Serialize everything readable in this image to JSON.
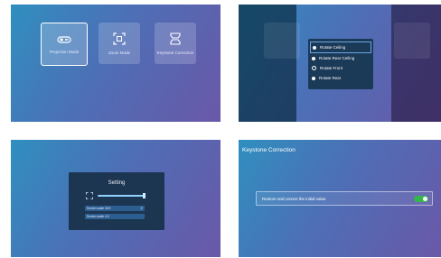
{
  "panel1": {
    "tiles": [
      {
        "label": "Projection Mode",
        "icon": "projector-icon",
        "selected": true
      },
      {
        "label": "Zoom Mode",
        "icon": "zoom-frame-icon",
        "selected": false
      },
      {
        "label": "Keystone Correction",
        "icon": "keystone-icon",
        "selected": false
      }
    ]
  },
  "panel2": {
    "menu": [
      {
        "label": "Rotate Ceiling",
        "selected": true
      },
      {
        "label": "Rotate Rear Ceiling",
        "selected": false
      },
      {
        "label": "Rotate Front",
        "selected": false
      },
      {
        "label": "Rotate Rear",
        "selected": false
      }
    ]
  },
  "panel3": {
    "title": "Setting",
    "options": [
      {
        "label": "Screen scale 16:9",
        "icon": "search-icon"
      },
      {
        "label": "Screen scale 4:3"
      }
    ],
    "slider_level": 1.0
  },
  "panel4": {
    "title": "Keystone Correction",
    "row_label": "Restore and correct the initial value",
    "toggle_on": true,
    "accent": "#36b64a"
  }
}
